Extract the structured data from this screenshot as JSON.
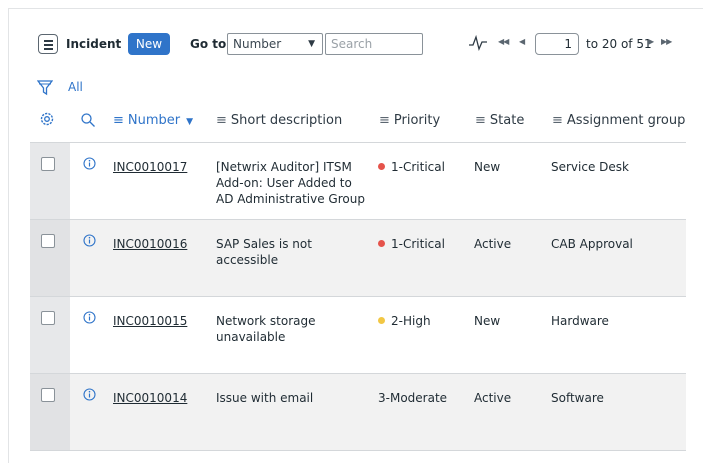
{
  "toolbar": {
    "title": "Incident",
    "new_label": "New",
    "goto_label": "Go to",
    "goto_field": "Number",
    "search_placeholder": "Search",
    "page_value": "1",
    "range_text": "to 20 of 51",
    "accent": "#2f74c9"
  },
  "filter": {
    "label": "All"
  },
  "columns": [
    {
      "label": "Number",
      "sorted": true
    },
    {
      "label": "Short description"
    },
    {
      "label": "Priority"
    },
    {
      "label": "State"
    },
    {
      "label": "Assignment group"
    }
  ],
  "rows": [
    {
      "number": "INC0010017",
      "description": "[Netwrix Auditor] ITSM Add-on: User Added to AD Administrative Group",
      "priority": "1-Critical",
      "priority_color": "#e5534b",
      "state": "New",
      "group": "Service Desk"
    },
    {
      "number": "INC0010016",
      "description": "SAP Sales is not accessible",
      "priority": "1-Critical",
      "priority_color": "#e5534b",
      "state": "Active",
      "group": "CAB Approval"
    },
    {
      "number": "INC0010015",
      "description": "Network storage unavailable",
      "priority": "2-High",
      "priority_color": "#f2c744",
      "state": "New",
      "group": "Hardware"
    },
    {
      "number": "INC0010014",
      "description": "Issue with email",
      "priority": "3-Moderate",
      "priority_color": "",
      "state": "Active",
      "group": "Software"
    }
  ]
}
